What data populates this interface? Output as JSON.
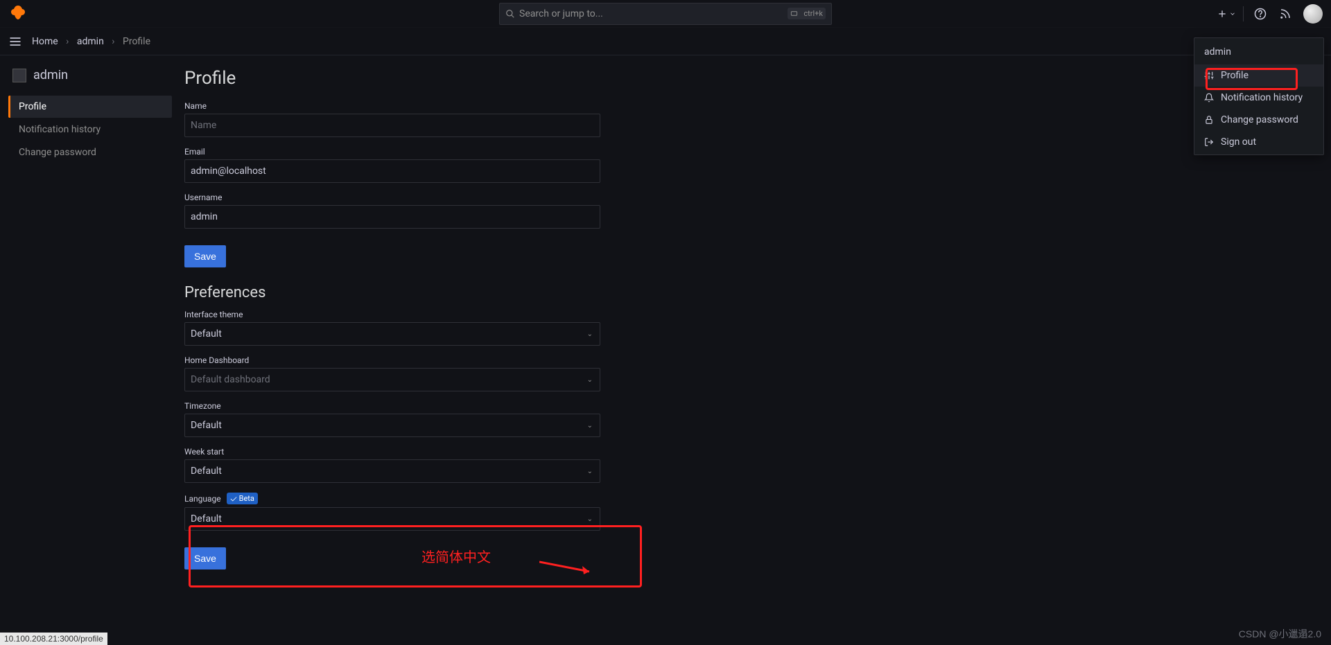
{
  "search": {
    "placeholder": "Search or jump to...",
    "kbd": "ctrl+k"
  },
  "breadcrumbs": {
    "home": "Home",
    "admin": "admin",
    "profile": "Profile"
  },
  "sidebar": {
    "title": "admin",
    "items": [
      {
        "label": "Profile",
        "active": true
      },
      {
        "label": "Notification history",
        "active": false
      },
      {
        "label": "Change password",
        "active": false
      }
    ]
  },
  "profile": {
    "heading": "Profile",
    "name": {
      "label": "Name",
      "placeholder": "Name",
      "value": ""
    },
    "email": {
      "label": "Email",
      "value": "admin@localhost"
    },
    "username": {
      "label": "Username",
      "value": "admin"
    },
    "save": "Save"
  },
  "prefs": {
    "heading": "Preferences",
    "theme": {
      "label": "Interface theme",
      "value": "Default"
    },
    "home": {
      "label": "Home Dashboard",
      "placeholder": "Default dashboard",
      "value": ""
    },
    "tz": {
      "label": "Timezone",
      "value": "Default"
    },
    "week": {
      "label": "Week start",
      "value": "Default"
    },
    "lang": {
      "label": "Language",
      "badge": "Beta",
      "value": "Default"
    },
    "save": "Save"
  },
  "userMenu": {
    "name": "admin",
    "items": [
      {
        "label": "Profile",
        "icon": "sliders",
        "hl": true
      },
      {
        "label": "Notification history",
        "icon": "bell",
        "hl": false
      },
      {
        "label": "Change password",
        "icon": "lock",
        "hl": false
      },
      {
        "label": "Sign out",
        "icon": "signout",
        "hl": false
      }
    ]
  },
  "annotation": {
    "text": "选简体中文"
  },
  "status_url": "10.100.208.21:3000/profile",
  "watermark": "CSDN @小邋遢2.0"
}
